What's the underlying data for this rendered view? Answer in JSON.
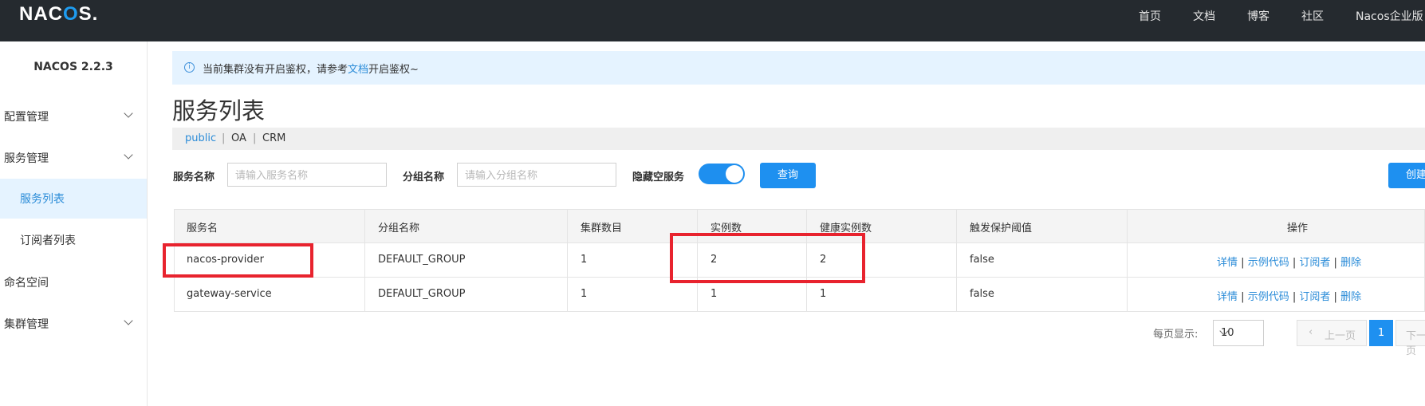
{
  "header": {
    "logo": "NACOS.",
    "nav": [
      "首页",
      "文档",
      "博客",
      "社区",
      "Nacos企业版"
    ]
  },
  "sidebar": {
    "version": "NACOS 2.2.3",
    "items": [
      {
        "label": "配置管理"
      },
      {
        "label": "服务管理"
      },
      {
        "label": "服务列表"
      },
      {
        "label": "订阅者列表"
      },
      {
        "label": "命名空间"
      },
      {
        "label": "集群管理"
      }
    ]
  },
  "notice": {
    "prefix": "当前集群没有开启鉴权，请参考",
    "link": "文档",
    "suffix": "开启鉴权~"
  },
  "page": {
    "title": "服务列表",
    "namespaces": [
      "public",
      "OA",
      "CRM"
    ]
  },
  "filters": {
    "service_label": "服务名称",
    "service_placeholder": "请输入服务名称",
    "group_label": "分组名称",
    "group_placeholder": "请输入分组名称",
    "hide_empty_label": "隐藏空服务",
    "hide_empty_on": true,
    "query_button": "查询",
    "create_button": "创建"
  },
  "table": {
    "columns": [
      "服务名",
      "分组名称",
      "集群数目",
      "实例数",
      "健康实例数",
      "触发保护阈值",
      "操作"
    ],
    "rows": [
      {
        "name": "nacos-provider",
        "group": "DEFAULT_GROUP",
        "clusters": "1",
        "instances": "2",
        "healthy": "2",
        "threshold": "false"
      },
      {
        "name": "gateway-service",
        "group": "DEFAULT_GROUP",
        "clusters": "1",
        "instances": "1",
        "healthy": "1",
        "threshold": "false"
      }
    ],
    "actions": [
      "详情",
      "示例代码",
      "订阅者",
      "删除"
    ],
    "separator": "|"
  },
  "pagination": {
    "page_size_label": "每页显示:",
    "page_size": "10",
    "prev": "上一页",
    "current": "1",
    "next": "下一页"
  },
  "colors": {
    "accent": "#1e90f0",
    "topbar": "#252a2f",
    "highlight_box": "#e8232e"
  }
}
